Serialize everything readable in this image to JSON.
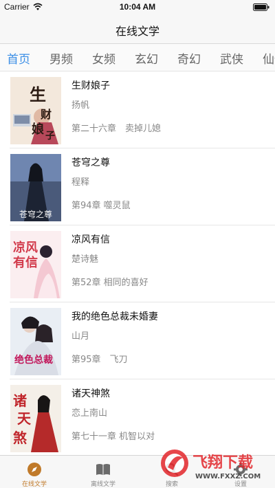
{
  "status_bar": {
    "carrier": "Carrier",
    "time": "10:04 AM"
  },
  "nav": {
    "title": "在线文学"
  },
  "categories": [
    {
      "label": "首页",
      "active": true
    },
    {
      "label": "男频",
      "active": false
    },
    {
      "label": "女频",
      "active": false
    },
    {
      "label": "玄幻",
      "active": false
    },
    {
      "label": "奇幻",
      "active": false
    },
    {
      "label": "武侠",
      "active": false
    },
    {
      "label": "仙侠",
      "active": false
    }
  ],
  "books": [
    {
      "title": "生财娘子",
      "author": "扬帆",
      "chapter": "第二十六章　卖掉儿媳",
      "cover_text": "生财娘子",
      "cover_color": "#f3e8dc"
    },
    {
      "title": "苍穹之尊",
      "author": "程释",
      "chapter": "第94章 噬灵鼠",
      "cover_text": "苍穹之尊",
      "cover_color": "#4a5a7a"
    },
    {
      "title": "凉风有信",
      "author": "楚诗魅",
      "chapter": "第52章 相同的喜好",
      "cover_text": "凉风有信",
      "cover_color": "#fbeef0"
    },
    {
      "title": "我的绝色总裁未婚妻",
      "author": "山月",
      "chapter": "第95章　飞刀",
      "cover_text": "绝色总裁",
      "cover_color": "#e9eef4"
    },
    {
      "title": "诸天神煞",
      "author": "恋上南山",
      "chapter": "第七十一章 机智以对",
      "cover_text": "诸天神煞",
      "cover_color": "#f4efe8"
    }
  ],
  "tabs": [
    {
      "label": "在线文学",
      "icon": "compass-icon",
      "active": true
    },
    {
      "label": "离线文学",
      "icon": "book-icon",
      "active": false
    },
    {
      "label": "搜索",
      "icon": "search-icon",
      "active": false
    },
    {
      "label": "设置",
      "icon": "gear-icon",
      "active": false
    }
  ],
  "watermark": {
    "brand": "飞翔下载",
    "url": "WWW.FXXZ.COM"
  },
  "colors": {
    "accent": "#3a8ee6",
    "tab_active": "#c07a2a",
    "watermark_red": "#e3262b"
  }
}
